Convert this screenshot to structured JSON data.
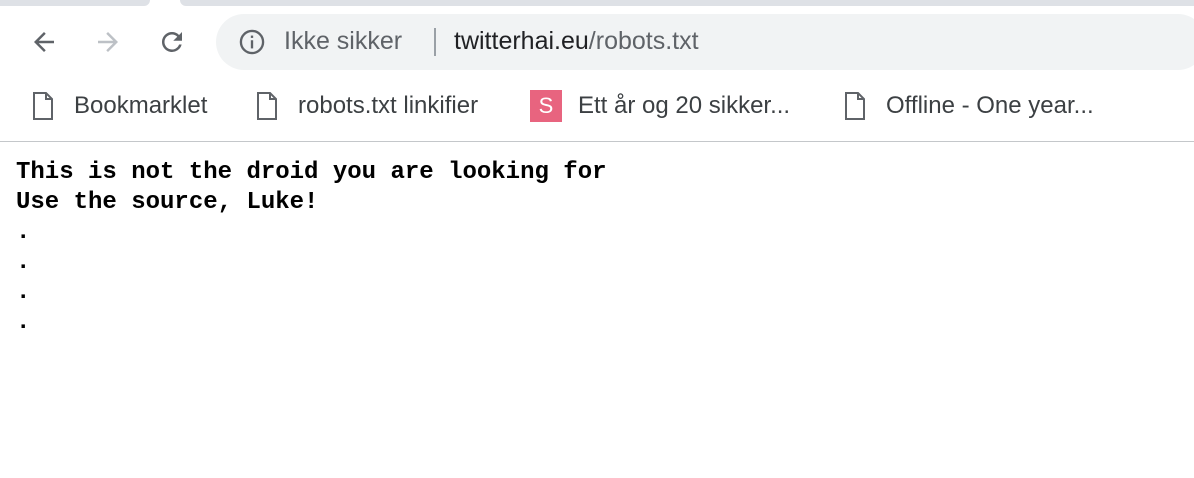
{
  "browser": {
    "icons": {
      "back": "arrow-left-icon",
      "forward": "arrow-right-icon",
      "reload": "reload-icon",
      "site_info": "info-icon"
    },
    "omnibox": {
      "security_label": "Ikke sikker",
      "url_host": "twitterhai.eu",
      "url_path": "/robots.txt"
    },
    "bookmarks": [
      {
        "label": "Bookmarklet",
        "icon": "page-icon"
      },
      {
        "label": "robots.txt linkifier",
        "icon": "page-icon"
      },
      {
        "label": "Ett år og 20 sikker...",
        "icon": "s-favicon",
        "icon_letter": "S",
        "icon_color": "#e8647f"
      },
      {
        "label": "Offline - One year...",
        "icon": "page-icon"
      }
    ]
  },
  "page": {
    "lines": [
      "This is not the droid you are looking for",
      "Use the source, Luke!",
      ".",
      ".",
      ".",
      "."
    ]
  }
}
